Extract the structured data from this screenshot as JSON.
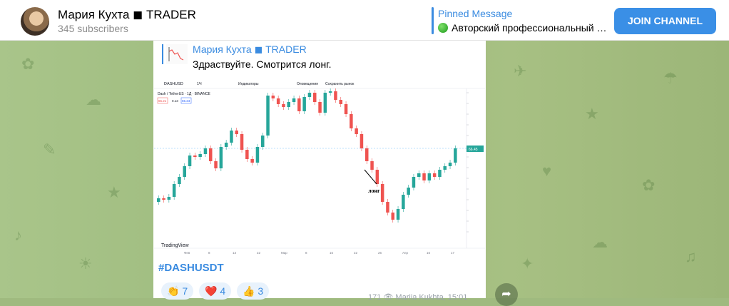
{
  "header": {
    "channel_title": "Мария Кухта ◼ TRADER",
    "subscribers": "345 subscribers",
    "pinned_title": "Pinned Message",
    "pinned_text": "Авторский профессиональный …",
    "join_label": "JOIN CHANNEL"
  },
  "message": {
    "reply_name": "Мария Кухта ◼ TRADER",
    "reply_text": "Здраствуйте. Смотрится лонг.",
    "hashtag": "#DASHUSDT",
    "reactions": [
      {
        "emoji": "👏",
        "count": "7"
      },
      {
        "emoji": "❤️",
        "count": "4"
      },
      {
        "emoji": "👍",
        "count": "3"
      }
    ],
    "meta": "171 👁 Mariia Kukhta, 15:01"
  },
  "chart_image": {
    "symbol": "DASHUSD",
    "interval": "1Ч",
    "toolbar_items": [
      "Индикаторы",
      "Оповещения",
      "Сохранить рынок"
    ],
    "legend": "Dash / TetherUS · 1Д · BINANCE",
    "price_boxes": [
      "65.21",
      "0.13",
      "65.34"
    ],
    "annotation": "лонг",
    "watermark": "TradingView",
    "x_labels": [
      "Фев",
      "8",
      "13",
      "22",
      "Мар",
      "8",
      "15",
      "22",
      "26",
      "Апр",
      "16",
      "17"
    ],
    "current_price": "66.45",
    "colors": {
      "up": "#26a69a",
      "down": "#ef5350"
    }
  }
}
